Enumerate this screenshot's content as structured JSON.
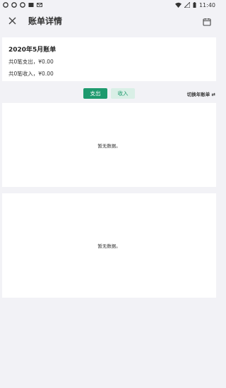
{
  "status_bar": {
    "time": "11:40"
  },
  "header": {
    "title": "账单详情"
  },
  "summary": {
    "month": "2020年5月账单",
    "expense_line": "共0笔支出，¥0.00",
    "income_line": "共0笔收入，¥0.00"
  },
  "toggle": {
    "expense_label": "支出",
    "income_label": "收入",
    "switch_year_label": "切换年账单 ⇄"
  },
  "panels": [
    {
      "empty_text": "暂无数据。"
    },
    {
      "empty_text": "暂无数据。"
    }
  ],
  "colors": {
    "accent": "#1e9a6e",
    "accent_light": "#d9efe6",
    "background": "#f2f2f6"
  }
}
